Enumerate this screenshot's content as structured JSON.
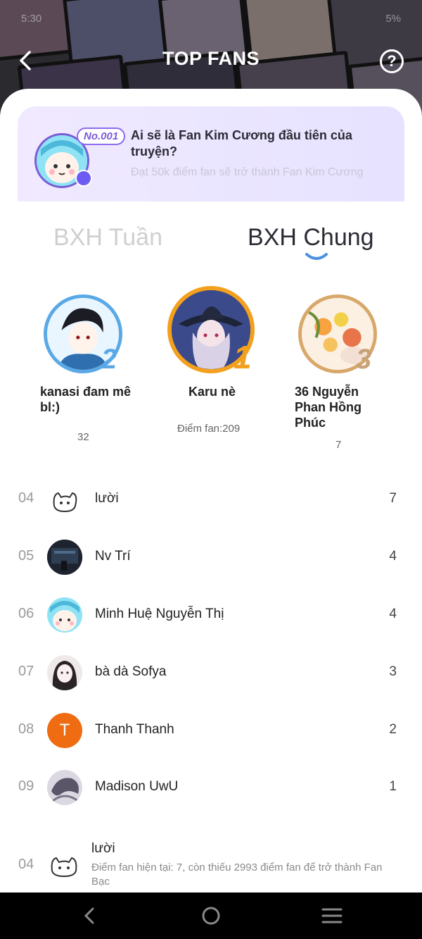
{
  "status": {
    "time": "5:30",
    "battery": "5%"
  },
  "header": {
    "title": "TOP FANS",
    "help": "?"
  },
  "promo": {
    "badge": "No.001",
    "headline": "Ai sẽ là Fan Kim Cương đầu tiên của truyện?",
    "subline": "Đạt 50k điểm fan sẽ trở thành Fan Kim Cương"
  },
  "tabs": {
    "weekly": "BXH Tuần",
    "overall": "BXH Chung"
  },
  "podium": {
    "first": {
      "rank": "1",
      "name": "Karu nè",
      "score": "Điểm fan:209"
    },
    "second": {
      "rank": "2",
      "name": "kanasi đam mê bl:)",
      "score": "32"
    },
    "third": {
      "rank": "3",
      "name": "36 Nguyễn Phan Hồng Phúc",
      "score": "7"
    }
  },
  "list": [
    {
      "rank": "04",
      "name": "lười",
      "score": "7"
    },
    {
      "rank": "05",
      "name": "Nv Trí",
      "score": "4"
    },
    {
      "rank": "06",
      "name": "Minh Huệ Nguyễn Thị",
      "score": "4"
    },
    {
      "rank": "07",
      "name": "bà dà Sofya",
      "score": "3"
    },
    {
      "rank": "08",
      "name": "Thanh Thanh",
      "score": "2",
      "initial": "T"
    },
    {
      "rank": "09",
      "name": "Madison UwU",
      "score": "1"
    }
  ],
  "me": {
    "rank": "04",
    "name": "lười",
    "info": "Điểm fan hiện tại: 7, còn thiếu 2993 điểm fan để trở thành Fan Bạc"
  },
  "colors": {
    "accent": "#7b5bd6",
    "gold": "#f2a01e",
    "silver": "#5aa9e6",
    "bronze": "#d8a86a",
    "orange_avatar": "#ef6c12"
  }
}
